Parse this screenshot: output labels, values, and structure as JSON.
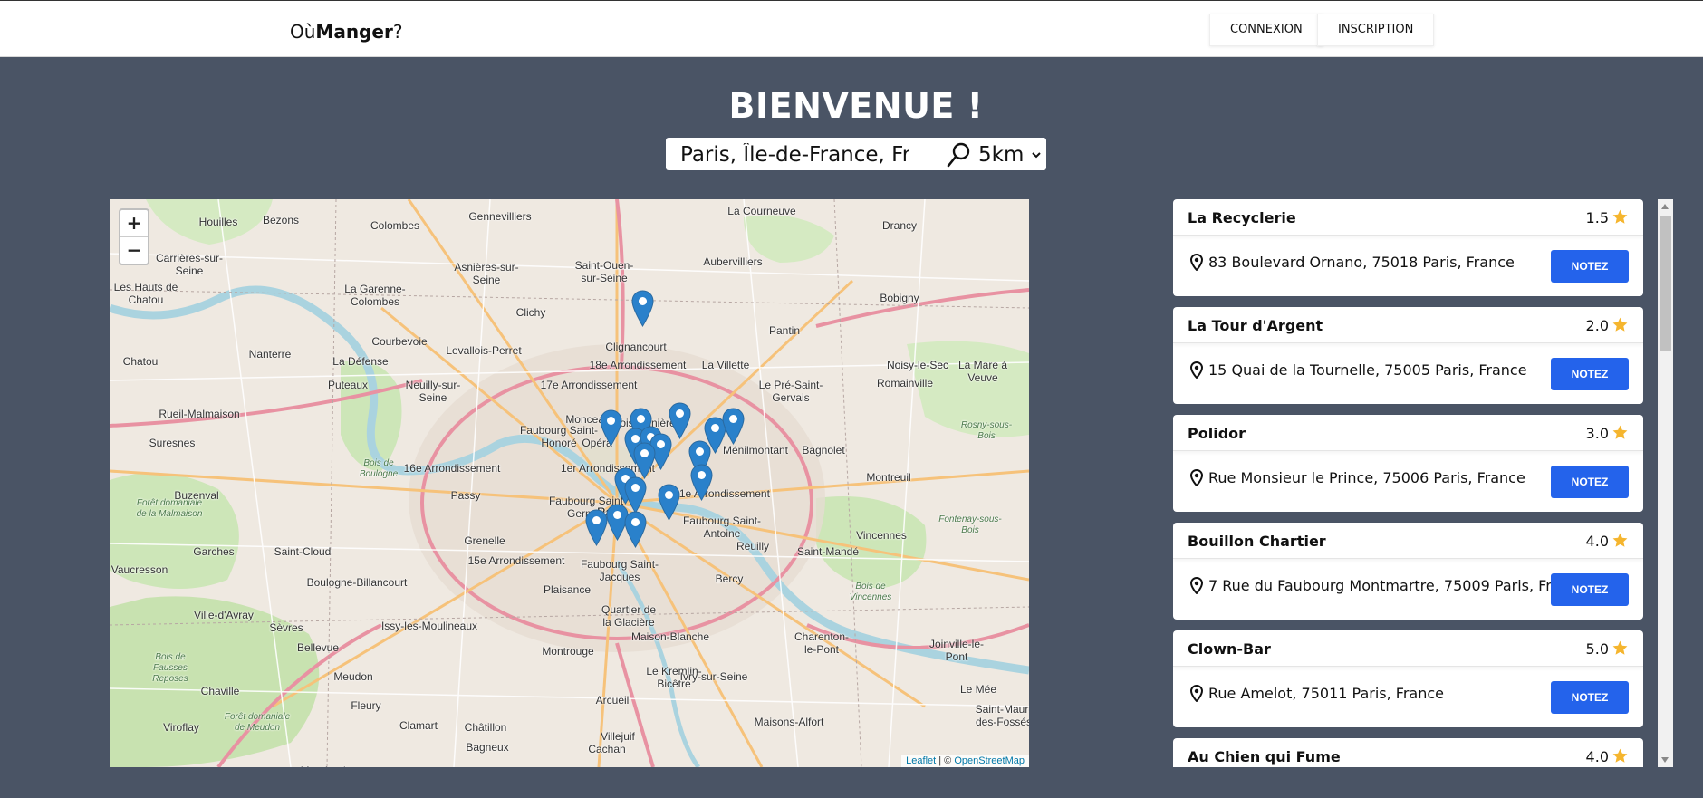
{
  "header": {
    "logo_prefix": "Où",
    "logo_strong": "Manger",
    "logo_suffix": "?",
    "login_label": "CONNEXION",
    "signup_label": "INSCRIPTION"
  },
  "main": {
    "title": "BIENVENUE !",
    "search_value": "Paris, Île-de-France, France",
    "radius_selected": "5km",
    "radius_options": [
      "5km"
    ]
  },
  "map": {
    "zoom_in": "+",
    "zoom_out": "−",
    "attribution_leaflet": "Leaflet",
    "attribution_sep": " | © ",
    "attribution_osm": "OpenStreetMap",
    "marker_color": "#2a81cb",
    "labels": [
      "Houilles",
      "Bezons",
      "Colombes",
      "Gennevilliers",
      "La Courneuve",
      "Drancy",
      "Carrières-sur-\nSeine",
      "Asnières-sur-\nSeine",
      "Saint-Ouen-\nsur-Seine",
      "Aubervilliers",
      "Bobigny",
      "Les Hauts de\nChatou",
      "La Garenne-\nColombes",
      "Clichy",
      "Pantin",
      "Chatou",
      "Nanterre",
      "Courbevoie",
      "Levallois-Perret",
      "Clignancourt",
      "La Défense",
      "18e Arrondissement",
      "La Villette",
      "Noisy-le-Sec",
      "Puteaux",
      "Neuilly-sur-\nSeine",
      "17e Arrondissement",
      "Le Pré-Saint-\nGervais",
      "Romainville",
      "Rueil-Malmaison",
      "Monceau",
      "Faubourg Saint-\nHonoré",
      "Poissonnière",
      "Opéra",
      "Suresnes",
      "Ménilmontant",
      "Bagnolet",
      "Bois de\nBoulogne",
      "16e Arrondissement",
      "1er Arrondissement",
      "Montreuil",
      "Rosny-sous-\nBois",
      "Buzenval",
      "Passy",
      "Faubourg Saint-\nGermain",
      "Paris",
      "11e Arrondissement",
      "Forêt domaniale\nde la Malmaison",
      "Faubourg Saint-\nAntoine",
      "Fontenay-sous-\nBois",
      "Grenelle",
      "Reuilly",
      "Vincennes",
      "Garches",
      "Saint-Cloud",
      "15e Arrondissement",
      "Faubourg Saint-\nJacques",
      "Saint-Mandé",
      "Vaucresson",
      "Boulogne-Billancourt",
      "Bercy",
      "Plaisance",
      "Bois de\nVincennes",
      "Quartier de\nla Glacière",
      "Ville-d'Avray",
      "Sèvres",
      "Issy-les-Moulineaux",
      "Maison-Blanche",
      "Charenton-\nle-Pont",
      "Joinville-le-\nPont",
      "Bellevue",
      "Montrouge",
      "Meudon",
      "Le Kremlin-\nBicêtre",
      "Ivry-sur-Seine",
      "Chaville",
      "Fleury",
      "Arcueil",
      "Maisons-Alfort",
      "Saint-Maur-\ndes-Fossés",
      "Viroflay",
      "Forêt domaniale\nde Meudon",
      "Clamart",
      "Châtillon",
      "Villejuif",
      "Bagneux",
      "Cachan",
      "Meudon-la-",
      "Bois de\nFausses\nReposes",
      "Le Mée",
      "La Mare à\nVeuve",
      "Noisy-le-Sec"
    ]
  },
  "restaurants": [
    {
      "name": "La Recyclerie",
      "rating": "1.5",
      "address": "83 Boulevard Ornano, 75018 Paris, France",
      "action": "NOTEZ"
    },
    {
      "name": "La Tour d'Argent",
      "rating": "2.0",
      "address": "15 Quai de la Tournelle, 75005 Paris, France",
      "action": "NOTEZ"
    },
    {
      "name": "Polidor",
      "rating": "3.0",
      "address": "Rue Monsieur le Prince, 75006 Paris, France",
      "action": "NOTEZ"
    },
    {
      "name": "Bouillon Chartier",
      "rating": "4.0",
      "address": "7 Rue du Faubourg Montmartre, 75009 Paris, France",
      "action": "NOTEZ"
    },
    {
      "name": "Clown-Bar",
      "rating": "5.0",
      "address": "Rue Amelot, 75011 Paris, France",
      "action": "NOTEZ"
    },
    {
      "name": "Au Chien qui Fume",
      "rating": "4.0",
      "address": "",
      "action": "NOTEZ"
    }
  ],
  "colors": {
    "background": "#4a5465",
    "button": "#2463eb",
    "star": "#f5b52e"
  }
}
